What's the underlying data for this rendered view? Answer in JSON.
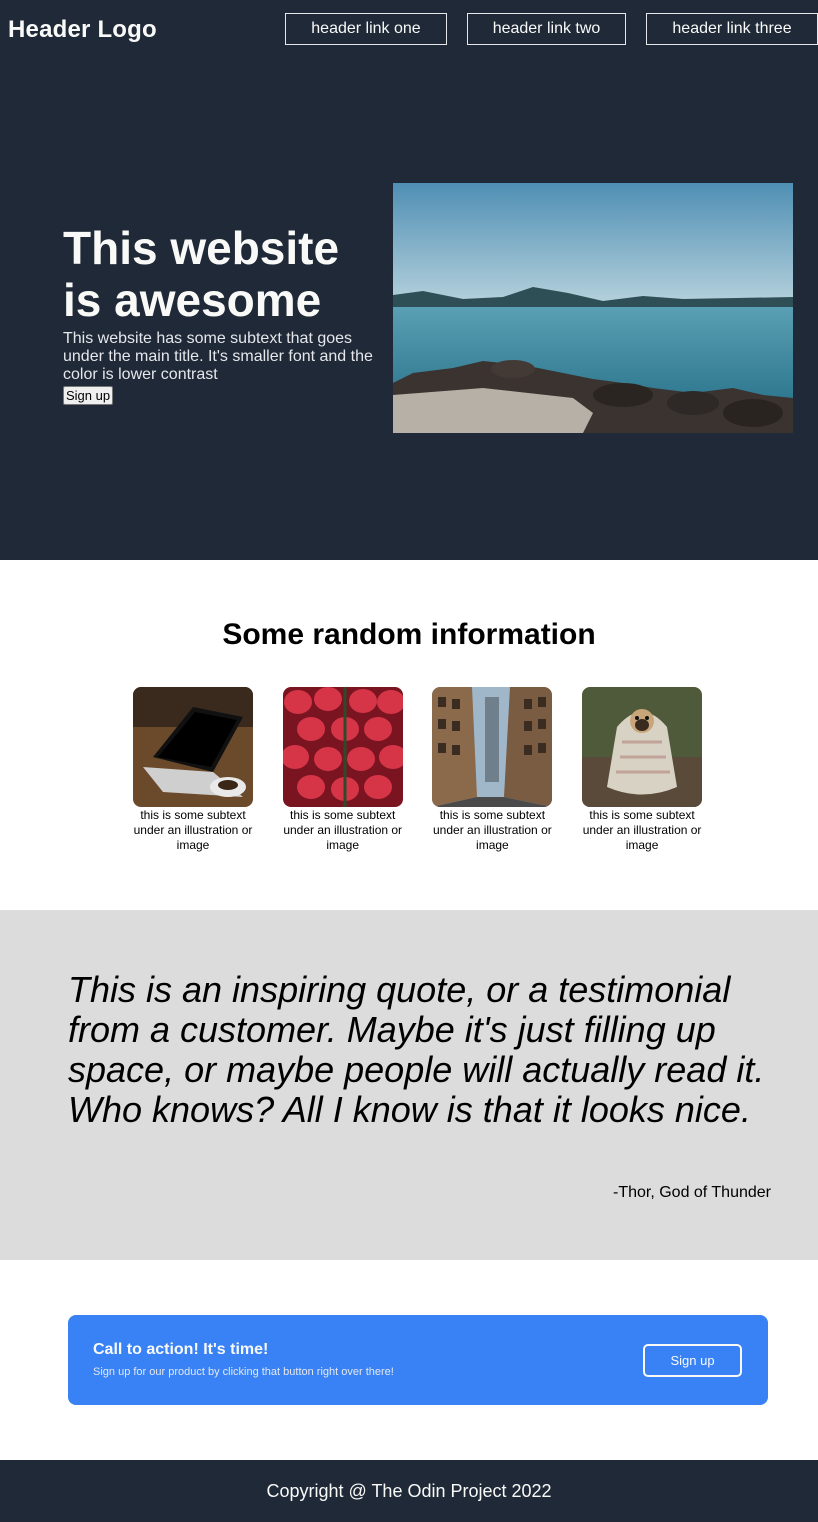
{
  "header": {
    "logo": "Header Logo",
    "links": [
      "header link one",
      "header link two",
      "header link three"
    ]
  },
  "hero": {
    "title": "This website is awesome",
    "subtext": "This website has some subtext that goes under the main title. It's smaller font and the color is lower contrast",
    "button_label": "Sign up",
    "image_icon": "lake-landscape-image"
  },
  "info": {
    "title": "Some random information",
    "cards": [
      {
        "image_icon": "laptop-image",
        "text": "this is some subtext under an illustration or image"
      },
      {
        "image_icon": "strawberries-image",
        "text": "this is some subtext under an illustration or image"
      },
      {
        "image_icon": "city-street-image",
        "text": "this is some subtext under an illustration or image"
      },
      {
        "image_icon": "pug-in-blanket-image",
        "text": "this is some subtext under an illustration or image"
      }
    ]
  },
  "quote": {
    "text": "This is an inspiring quote, or a testimonial from a customer. Maybe it's just filling up space, or maybe people will actually read it. Who knows? All I know is that it looks nice.",
    "author": "-Thor, God of Thunder"
  },
  "cta": {
    "title": "Call to action! It's time!",
    "subtext": "Sign up for our product by clicking that button right over there!",
    "button_label": "Sign up"
  },
  "footer": {
    "copyright": "Copyright @ The Odin Project 2022"
  },
  "colors": {
    "dark_bg": "#1f2937",
    "light_text": "#f9faf8",
    "muted_text": "#e5e7eb",
    "accent_blue": "#3882f6",
    "quote_bg": "#dcdcdc"
  }
}
